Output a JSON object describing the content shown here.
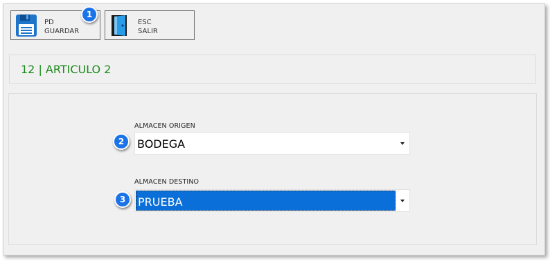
{
  "toolbar": {
    "save": {
      "key": "PD",
      "label": "GUARDAR",
      "icon": "floppy-disk-icon"
    },
    "exit": {
      "key": "ESC",
      "label": "SALIR",
      "icon": "door-exit-icon"
    }
  },
  "header": {
    "title": "12 | ARTICULO 2"
  },
  "form": {
    "origin": {
      "label": "ALMACEN ORIGEN",
      "value": "BODEGA"
    },
    "destination": {
      "label": "ALMACEN DESTINO",
      "value": "PRUEBA"
    }
  },
  "callouts": [
    "1",
    "2",
    "3"
  ],
  "colors": {
    "accent": "#1a73e8",
    "title": "#1a8a1a",
    "selection": "#0a6fd8"
  }
}
